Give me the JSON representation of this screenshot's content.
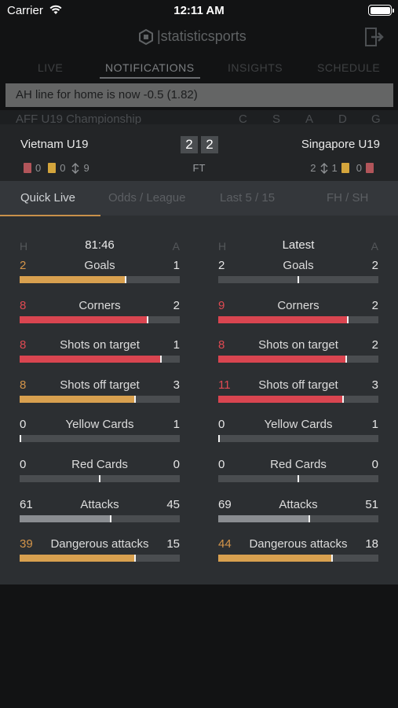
{
  "status_bar": {
    "carrier": "Carrier",
    "time": "12:11 AM"
  },
  "background": {
    "logo_text": "|statisticsports",
    "tabs": [
      "LIVE",
      "NOTIFICATIONS",
      "INSIGHTS",
      "SCHEDULE"
    ],
    "active_tab": "NOTIFICATIONS",
    "banner": "AH line for home is now -0.5 (1.82)",
    "league": "AFF U19 Championship",
    "league_cols": [
      "C",
      "S",
      "A",
      "D",
      "G"
    ]
  },
  "match": {
    "home_team": "Vietnam U19",
    "away_team": "Singapore U19",
    "home_score": "2",
    "away_score": "2",
    "status": "FT",
    "home_red": "0",
    "home_yellow": "0",
    "home_subs": "9",
    "away_subs": "2",
    "away_yellow": "1",
    "away_red": "0"
  },
  "subtabs": [
    "Quick Live",
    "Odds / League",
    "Last 5 / 15",
    "FH / SH"
  ],
  "active_subtab": "Quick Live",
  "colors": {
    "accent_orange": "#d8a04f",
    "accent_red": "#d94550",
    "neutral_bar": "#8a8d91",
    "track": "#4a4d50"
  },
  "columns": [
    {
      "h_label": "H",
      "a_label": "A",
      "title": "81:46",
      "stats": [
        {
          "label": "Goals",
          "home": "2",
          "away": "1",
          "home_share": 0.66,
          "color": "orange"
        },
        {
          "label": "Corners",
          "home": "8",
          "away": "2",
          "home_share": 0.8,
          "color": "red"
        },
        {
          "label": "Shots on target",
          "home": "8",
          "away": "1",
          "home_share": 0.88,
          "color": "red"
        },
        {
          "label": "Shots off target",
          "home": "8",
          "away": "3",
          "home_share": 0.72,
          "color": "orange"
        },
        {
          "label": "Yellow Cards",
          "home": "0",
          "away": "1",
          "home_share": 0.0,
          "color": "none"
        },
        {
          "label": "Red Cards",
          "home": "0",
          "away": "0",
          "home_share": 0.5,
          "color": "none"
        },
        {
          "label": "Attacks",
          "home": "61",
          "away": "45",
          "home_share": 0.57,
          "color": "gray"
        },
        {
          "label": "Dangerous attacks",
          "home": "39",
          "away": "15",
          "home_share": 0.72,
          "color": "orange"
        }
      ]
    },
    {
      "h_label": "H",
      "a_label": "A",
      "title": "Latest",
      "stats": [
        {
          "label": "Goals",
          "home": "2",
          "away": "2",
          "home_share": 0.5,
          "color": "none"
        },
        {
          "label": "Corners",
          "home": "9",
          "away": "2",
          "home_share": 0.81,
          "color": "red"
        },
        {
          "label": "Shots on target",
          "home": "8",
          "away": "2",
          "home_share": 0.8,
          "color": "red"
        },
        {
          "label": "Shots off target",
          "home": "11",
          "away": "3",
          "home_share": 0.78,
          "color": "red"
        },
        {
          "label": "Yellow Cards",
          "home": "0",
          "away": "1",
          "home_share": 0.0,
          "color": "none"
        },
        {
          "label": "Red Cards",
          "home": "0",
          "away": "0",
          "home_share": 0.5,
          "color": "none"
        },
        {
          "label": "Attacks",
          "home": "69",
          "away": "51",
          "home_share": 0.57,
          "color": "gray"
        },
        {
          "label": "Dangerous attacks",
          "home": "44",
          "away": "18",
          "home_share": 0.71,
          "color": "orange"
        }
      ]
    }
  ]
}
